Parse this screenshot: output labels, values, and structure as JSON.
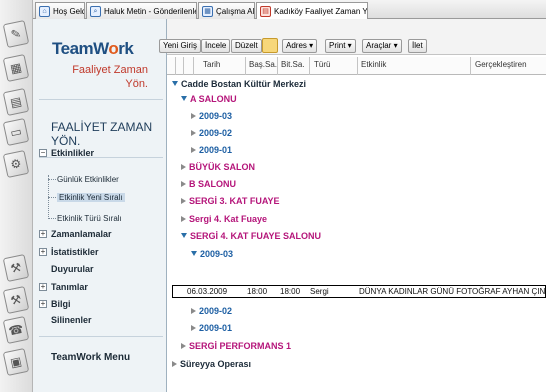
{
  "launcher": {
    "icons": [
      "app-launcher-icon",
      "notes-icon",
      "calendar-icon",
      "clipboard-icon",
      "gear-icon",
      "tools-icon",
      "tools-icon",
      "phone-icon",
      "folder-icon",
      "document-icon"
    ]
  },
  "tabs": [
    {
      "label": "Hoş Geldiniz"
    },
    {
      "label": "Haluk Metin - Gönderilenler"
    },
    {
      "label": "Çalışma Alanı"
    },
    {
      "label": "Kadıköy Faaliyet Zaman Yöneti..."
    }
  ],
  "sidebar": {
    "logo_prefix": "TeamW",
    "logo_o": "o",
    "logo_suffix": "rk",
    "subtitle_line1": "Faaliyet Zaman",
    "subtitle_line2": "Yön.",
    "section_title_line1": "FAALİYET ZAMAN",
    "section_title_line2": "YÖN.",
    "tree": {
      "etkinlikler": "Etkinlikler",
      "gunluk": "Günlük Etkinlikler",
      "yeni_sirali": "Etkinlik Yeni Sıralı",
      "turu_sirali": "Etkinlik Türü Sıralı",
      "zamanlamalar": "Zamanlamalar",
      "istatistikler": "İstatistikler",
      "duyurular": "Duyurular",
      "tanimlar": "Tanımlar",
      "bilgi": "Bilgi",
      "silinenler": "Silinenler"
    },
    "menu_label": "TeamWork Menu"
  },
  "toolbar": {
    "new": "Yeni Giriş",
    "review": "İncele",
    "edit": "Düzelt",
    "actions": "Adres ▾",
    "print": "Print ▾",
    "tools": "Araçlar ▾",
    "last": "İlet"
  },
  "columns": {
    "tarih": "Tarih",
    "bas": "Baş.Sa.",
    "bit": "Bit.Sa.",
    "turu": "Türü",
    "etkinlik": "Etkinlik",
    "gerceklestiren": "Gerçekleştiren"
  },
  "tree_rows": {
    "cadde": "Cadde Bostan Kültür Merkezi",
    "a_salonu": "A SALONU",
    "y2009_03a": "2009-03",
    "y2009_02a": "2009-02",
    "y2009_01a": "2009-01",
    "buyuk": "BÜYÜK SALON",
    "b_salonu": "B SALONU",
    "sergi3": "SERGİ 3. KAT FUAYE",
    "sergi4a": "Sergi 4. Kat Fuaye",
    "sergi4b": "SERGİ 4. KAT FUAYE SALONU",
    "y2009_03b": "2009-03",
    "y2009_02b": "2009-02",
    "y2009_01b": "2009-01",
    "performans": "SERGİ PERFORMANS 1",
    "sureyya": "Süreyya Operası"
  },
  "event_row": {
    "date": "06.03.2009",
    "start": "18:00",
    "end": "18:00",
    "type": "Sergi",
    "name": "DÜNYA KADINLAR GÜNÜ FOTOĞRAF AYHAN ÇINEI"
  }
}
